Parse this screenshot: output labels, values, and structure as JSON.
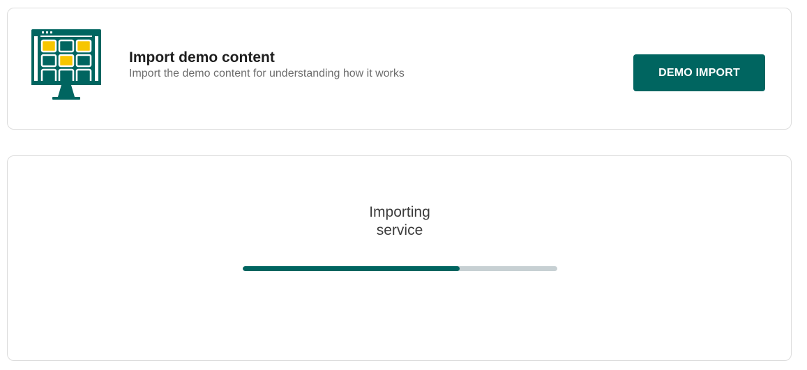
{
  "colors": {
    "accent": "#006560",
    "highlight": "#f7c600",
    "progress_track": "#c7d0d3"
  },
  "import_card": {
    "icon": "monitor-grid-icon",
    "title": "Import demo content",
    "subtitle": "Import the demo content for understanding how it works",
    "button_label": "DEMO IMPORT"
  },
  "progress_card": {
    "status_line1": "Importing",
    "status_line2": "service",
    "progress_fraction": 0.69
  }
}
